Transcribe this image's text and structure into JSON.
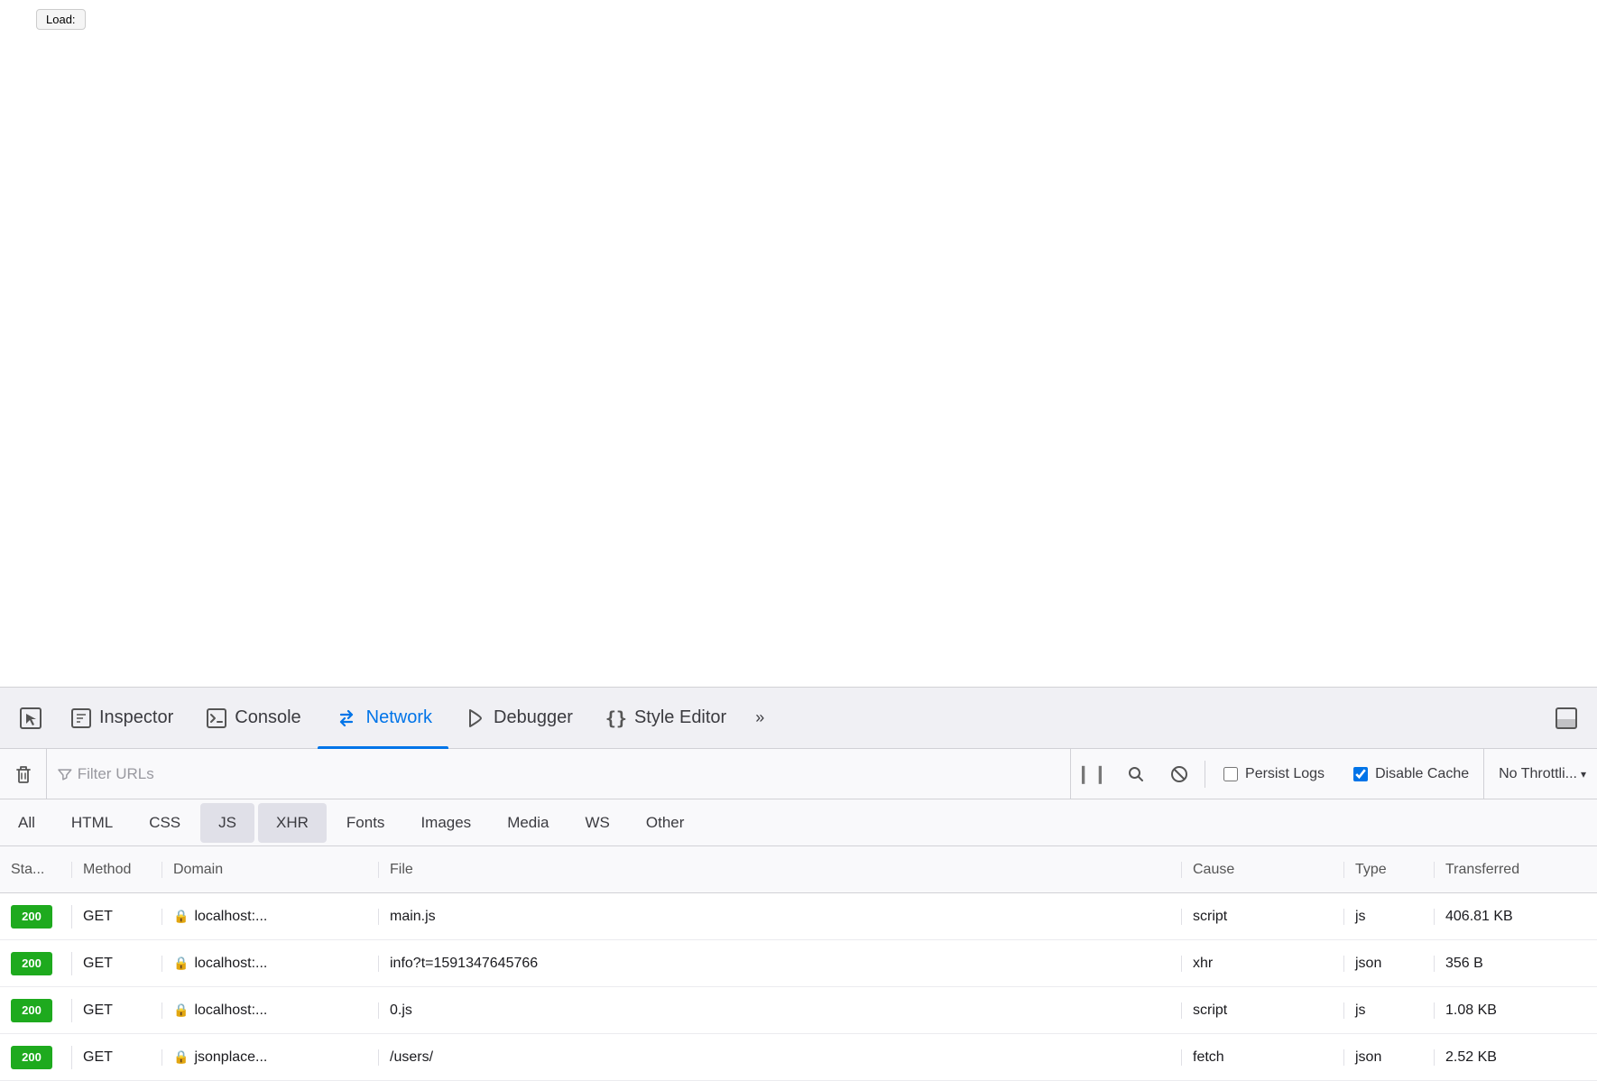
{
  "browser": {
    "load_button": "Load:"
  },
  "devtools": {
    "tabs": [
      {
        "id": "pick-element",
        "icon": "☛",
        "label": ""
      },
      {
        "id": "inspector",
        "icon": "▭",
        "label": "Inspector",
        "active": false
      },
      {
        "id": "console",
        "icon": "▷",
        "label": "Console",
        "active": false
      },
      {
        "id": "network",
        "icon": "⇅",
        "label": "Network",
        "active": true
      },
      {
        "id": "debugger",
        "icon": "▷",
        "label": "Debugger",
        "active": false
      },
      {
        "id": "style-editor",
        "icon": "{}",
        "label": "Style Editor",
        "active": false
      }
    ],
    "more_label": "»",
    "dock_icon": "⬛"
  },
  "toolbar": {
    "clear_label": "🗑",
    "filter_placeholder": "Filter URLs",
    "pause_label": "❙❙",
    "search_label": "🔍",
    "block_label": "🚫",
    "persist_logs_label": "Persist Logs",
    "persist_logs_checked": false,
    "disable_cache_label": "Disable Cache",
    "disable_cache_checked": true,
    "throttle_label": "No Throttli...",
    "throttle_arrow": "▾"
  },
  "filter_tabs": [
    {
      "id": "all",
      "label": "All",
      "active": false
    },
    {
      "id": "html",
      "label": "HTML",
      "active": false
    },
    {
      "id": "css",
      "label": "CSS",
      "active": false
    },
    {
      "id": "js",
      "label": "JS",
      "active": true
    },
    {
      "id": "xhr",
      "label": "XHR",
      "active": true
    },
    {
      "id": "fonts",
      "label": "Fonts",
      "active": false
    },
    {
      "id": "images",
      "label": "Images",
      "active": false
    },
    {
      "id": "media",
      "label": "Media",
      "active": false
    },
    {
      "id": "ws",
      "label": "WS",
      "active": false
    },
    {
      "id": "other",
      "label": "Other",
      "active": false
    }
  ],
  "table": {
    "headers": [
      {
        "id": "status",
        "label": "Sta..."
      },
      {
        "id": "method",
        "label": "Method"
      },
      {
        "id": "domain",
        "label": "Domain"
      },
      {
        "id": "file",
        "label": "File"
      },
      {
        "id": "cause",
        "label": "Cause"
      },
      {
        "id": "type",
        "label": "Type"
      },
      {
        "id": "transferred",
        "label": "Transferred"
      }
    ],
    "rows": [
      {
        "status": "200",
        "method": "GET",
        "domain": "localhost:...",
        "file": "main.js",
        "cause": "script",
        "type": "js",
        "transferred": "406.81 KB"
      },
      {
        "status": "200",
        "method": "GET",
        "domain": "localhost:...",
        "file": "info?t=1591347645766",
        "cause": "xhr",
        "type": "json",
        "transferred": "356 B"
      },
      {
        "status": "200",
        "method": "GET",
        "domain": "localhost:...",
        "file": "0.js",
        "cause": "script",
        "type": "js",
        "transferred": "1.08 KB"
      },
      {
        "status": "200",
        "method": "GET",
        "domain": "jsonplace...",
        "file": "/users/",
        "cause": "fetch",
        "type": "json",
        "transferred": "2.52 KB"
      }
    ]
  }
}
